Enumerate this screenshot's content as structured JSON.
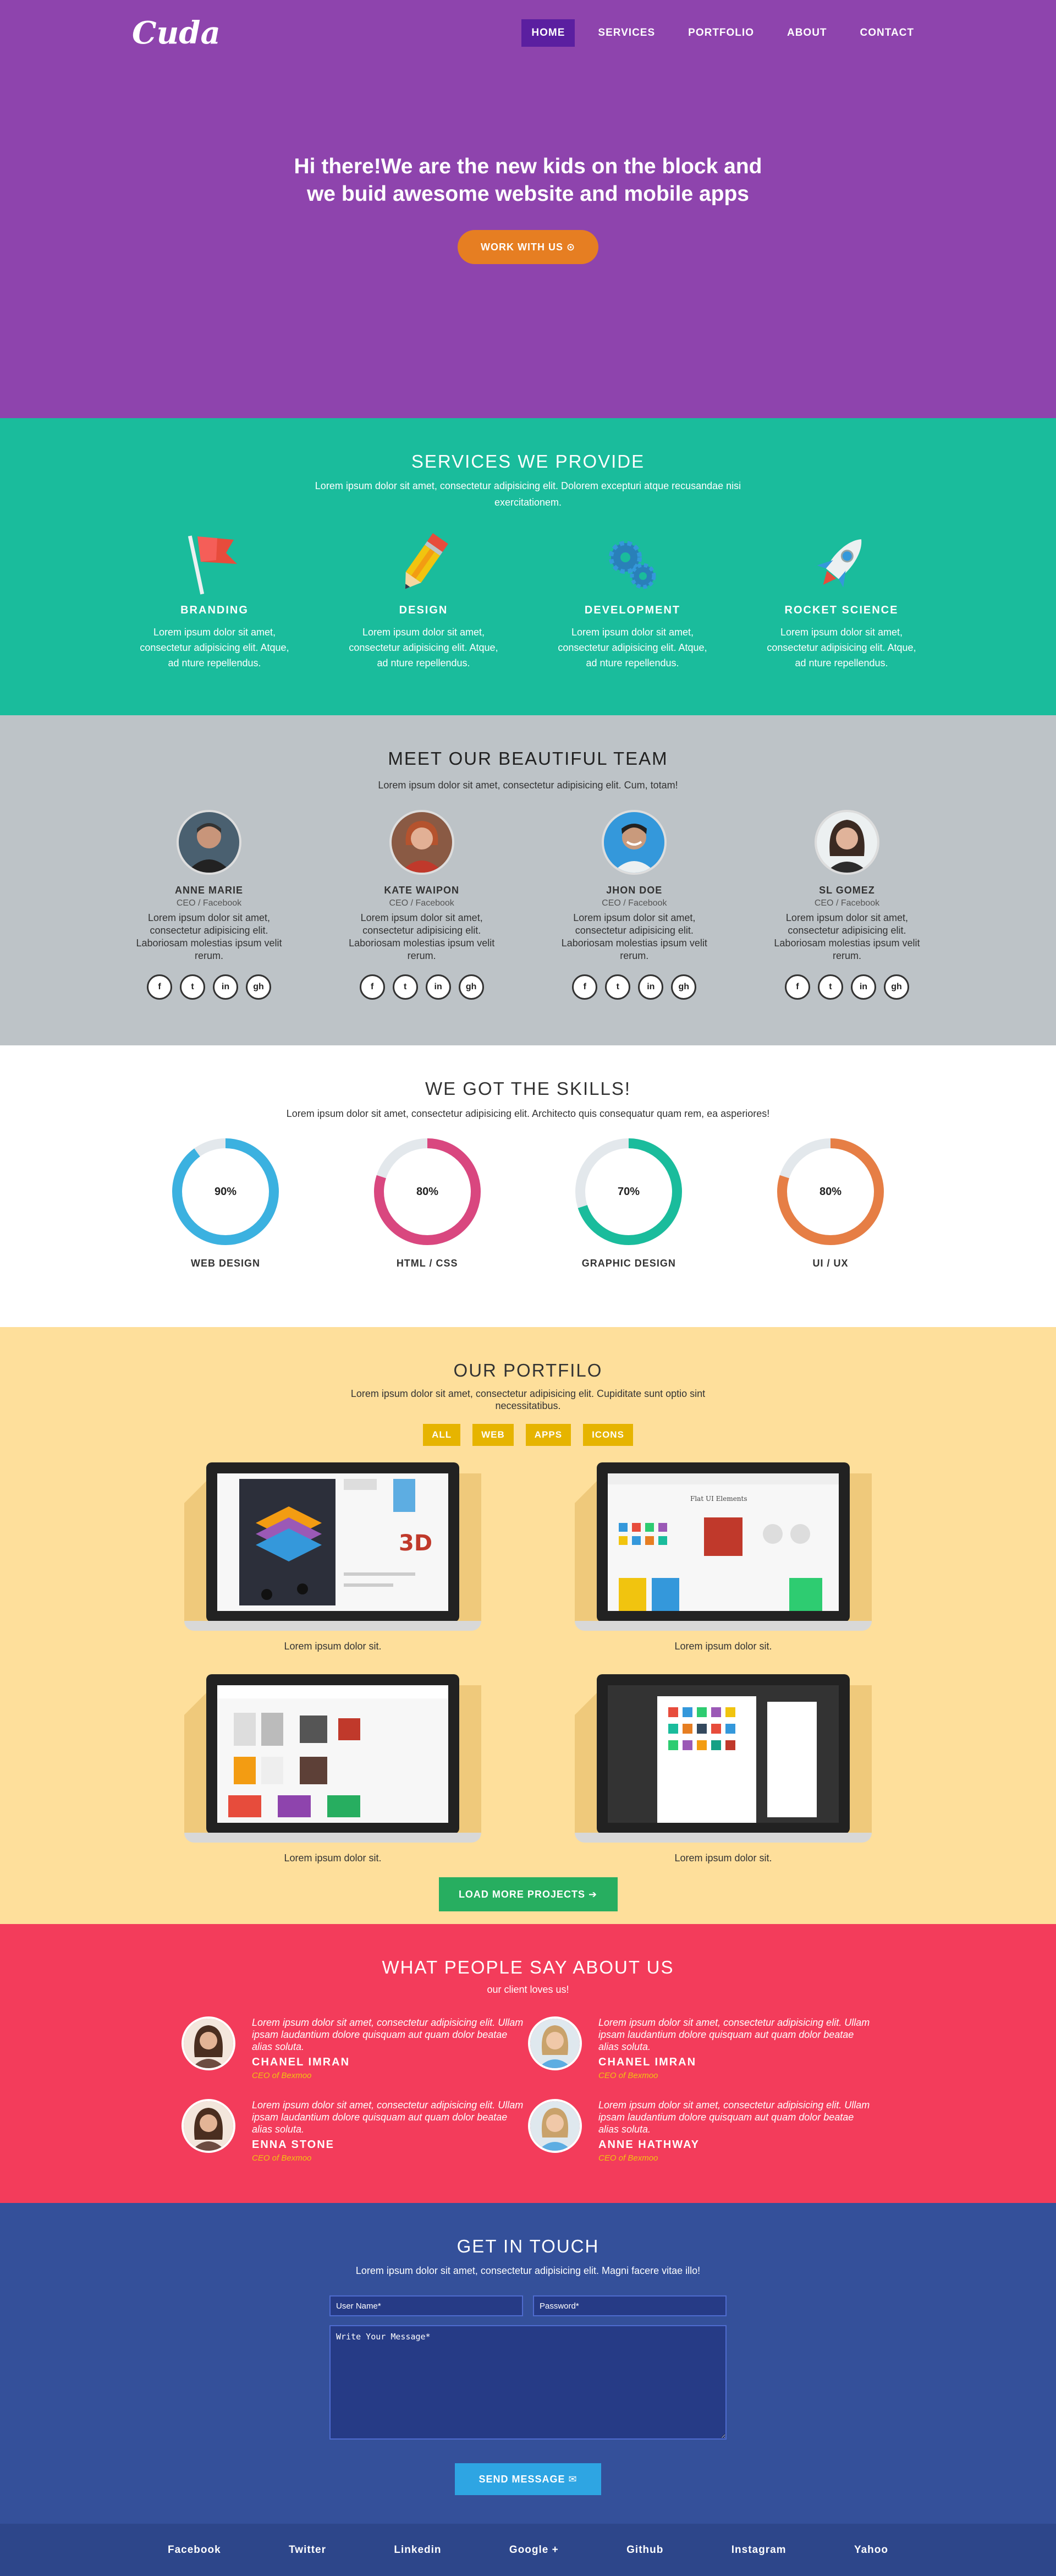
{
  "brand": {
    "logo": "Cuda"
  },
  "nav": {
    "items": [
      {
        "label": "HOME",
        "active": true
      },
      {
        "label": "SERVICES"
      },
      {
        "label": "PORTFOLIO"
      },
      {
        "label": "ABOUT"
      },
      {
        "label": "CONTACT"
      }
    ]
  },
  "hero": {
    "title_line1": "Hi there!We are the new kids on the block and",
    "title_line2": "we buid awesome website and mobile apps",
    "cta": "WORK WITH US ⊙"
  },
  "services": {
    "title": "SERVICES WE PROVIDE",
    "subtitle": "Lorem ipsum dolor sit amet, consectetur adipisicing elit. Dolorem excepturi atque recusandae nisi exercitationem.",
    "items": [
      {
        "icon": "flag-icon",
        "title": "BRANDING",
        "text": "Lorem ipsum dolor sit amet, consectetur adipisicing elit. Atque, ad nture repellendus."
      },
      {
        "icon": "pencil-icon",
        "title": "DESIGN",
        "text": "Lorem ipsum dolor sit amet, consectetur adipisicing elit. Atque, ad nture repellendus."
      },
      {
        "icon": "gears-icon",
        "title": "DEVELOPMENT",
        "text": "Lorem ipsum dolor sit amet, consectetur adipisicing elit. Atque, ad nture repellendus."
      },
      {
        "icon": "rocket-icon",
        "title": "ROCKET SCIENCE",
        "text": "Lorem ipsum dolor sit amet, consectetur adipisicing elit. Atque, ad nture repellendus."
      }
    ]
  },
  "team": {
    "title": "MEET OUR BEAUTIFUL TEAM",
    "subtitle": "Lorem ipsum dolor sit amet, consectetur adipisicing elit. Cum, totam!",
    "members": [
      {
        "name": "ANNE MARIE",
        "role": "CEO / Facebook",
        "text": "Lorem ipsum dolor sit amet, consectetur adipisicing elit. Laboriosam molestias ipsum velit rerum."
      },
      {
        "name": "KATE WAIPON",
        "role": "CEO / Facebook",
        "text": "Lorem ipsum dolor sit amet, consectetur adipisicing elit. Laboriosam molestias ipsum velit rerum."
      },
      {
        "name": "JHON DOE",
        "role": "CEO / Facebook",
        "text": "Lorem ipsum dolor sit amet, consectetur adipisicing elit. Laboriosam molestias ipsum velit rerum."
      },
      {
        "name": "SL GOMEZ",
        "role": "CEO / Facebook",
        "text": "Lorem ipsum dolor sit amet, consectetur adipisicing elit. Laboriosam molestias ipsum velit rerum."
      }
    ],
    "social_glyphs": {
      "facebook": "f",
      "twitter": "t",
      "linkedin": "in",
      "github": "gh"
    }
  },
  "skills": {
    "title": "WE GOT THE SKILLS!",
    "subtitle": "Lorem ipsum dolor sit amet, consectetur adipisicing elit. Architecto quis consequatur quam rem, ea asperiores!",
    "items": [
      {
        "label": "WEB DESIGN",
        "percent": 90,
        "display": "90%",
        "color": "#3bb1e0"
      },
      {
        "label": "HTML / CSS",
        "percent": 80,
        "display": "80%",
        "color": "#d9477f"
      },
      {
        "label": "GRAPHIC DESIGN",
        "percent": 70,
        "display": "70%",
        "color": "#1abc9c"
      },
      {
        "label": "UI / UX",
        "percent": 80,
        "display": "80%",
        "color": "#e67e45"
      }
    ]
  },
  "portfolio": {
    "title": "OUR PORTFILO",
    "subtitle": "Lorem ipsum dolor sit amet, consectetur adipisicing elit. Cupiditate sunt optio sint necessitatibus.",
    "filters": [
      "ALL",
      "WEB",
      "APPS",
      "ICONS"
    ],
    "items": [
      {
        "caption": "Lorem ipsum dolor sit."
      },
      {
        "caption": "Lorem ipsum dolor sit."
      },
      {
        "caption": "Lorem ipsum dolor sit."
      },
      {
        "caption": "Lorem ipsum dolor sit."
      }
    ],
    "load_more": "LOAD MORE PROJECTS ➔"
  },
  "testimonials": {
    "title": "WHAT PEOPLE SAY ABOUT US",
    "subtitle": "our client loves us!",
    "items": [
      {
        "quote": "Lorem ipsum dolor sit amet, consectetur adipisicing elit. Ullam ipsam laudantium dolore quisquam aut quam dolor beatae alias soluta.",
        "name": "CHANEL IMRAN",
        "role": "CEO of Bexmoo"
      },
      {
        "quote": "Lorem ipsum dolor sit amet, consectetur adipisicing elit. Ullam ipsam laudantium dolore quisquam aut quam dolor beatae alias soluta.",
        "name": "CHANEL IMRAN",
        "role": "CEO of Bexmoo"
      },
      {
        "quote": "Lorem ipsum dolor sit amet, consectetur adipisicing elit. Ullam ipsam laudantium dolore quisquam aut quam dolor beatae alias soluta.",
        "name": "ENNA STONE",
        "role": "CEO of Bexmoo"
      },
      {
        "quote": "Lorem ipsum dolor sit amet, consectetur adipisicing elit. Ullam ipsam laudantium dolore quisquam aut quam dolor beatae alias soluta.",
        "name": "ANNE HATHWAY",
        "role": "CEO of Bexmoo"
      }
    ]
  },
  "contact": {
    "title": "GET IN TOUCH",
    "subtitle": "Lorem ipsum dolor sit amet, consectetur adipisicing elit. Magni facere vitae illo!",
    "username_placeholder": "User Name*",
    "password_placeholder": "Password*",
    "message_placeholder": "Write Your Message*",
    "send": "SEND MESSAGE ✉"
  },
  "footer": {
    "links": [
      "Facebook",
      "Twitter",
      "Linkedin",
      "Google +",
      "Github",
      "Instagram",
      "Yahoo"
    ]
  }
}
